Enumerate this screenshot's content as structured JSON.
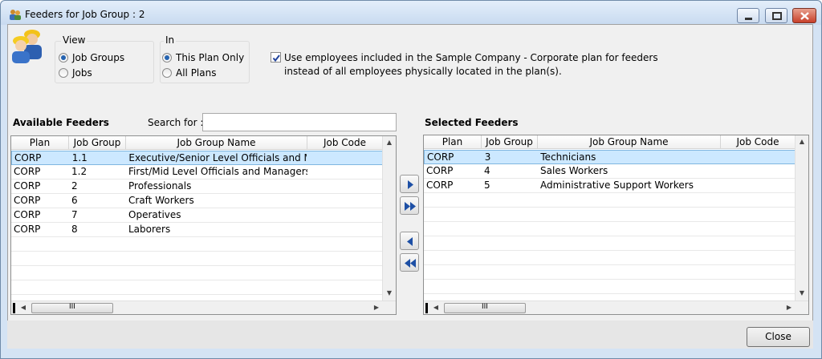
{
  "window": {
    "title": "Feeders for Job Group : 2"
  },
  "view_group": {
    "label": "View",
    "options": [
      {
        "label": "Job Groups",
        "selected": true
      },
      {
        "label": "Jobs",
        "selected": false
      }
    ]
  },
  "in_group": {
    "label": "In",
    "options": [
      {
        "label": "This Plan Only",
        "selected": true
      },
      {
        "label": "All Plans",
        "selected": false
      }
    ]
  },
  "use_employees": {
    "checked": true,
    "text": "Use employees included in the Sample Company - Corporate plan for feeders instead of all employees physically located in the plan(s)."
  },
  "available": {
    "title": "Available Feeders",
    "search_label": "Search for :",
    "search_value": "",
    "columns": [
      "Plan",
      "Job Group",
      "Job Group Name",
      "Job Code"
    ],
    "rows": [
      {
        "plan": "CORP",
        "job_group": "1.1",
        "name": "Executive/Senior Level Officials and Mana",
        "code": ""
      },
      {
        "plan": "CORP",
        "job_group": "1.2",
        "name": "First/Mid Level Officials and Managers",
        "code": ""
      },
      {
        "plan": "CORP",
        "job_group": "2",
        "name": "Professionals",
        "code": ""
      },
      {
        "plan": "CORP",
        "job_group": "6",
        "name": "Craft Workers",
        "code": ""
      },
      {
        "plan": "CORP",
        "job_group": "7",
        "name": "Operatives",
        "code": ""
      },
      {
        "plan": "CORP",
        "job_group": "8",
        "name": "Laborers",
        "code": ""
      }
    ]
  },
  "selected": {
    "title": "Selected Feeders",
    "columns": [
      "Plan",
      "Job Group",
      "Job Group Name",
      "Job Code"
    ],
    "rows": [
      {
        "plan": "CORP",
        "job_group": "3",
        "name": "Technicians",
        "code": ""
      },
      {
        "plan": "CORP",
        "job_group": "4",
        "name": "Sales Workers",
        "code": ""
      },
      {
        "plan": "CORP",
        "job_group": "5",
        "name": "Administrative Support Workers",
        "code": ""
      }
    ]
  },
  "buttons": {
    "close": "Close"
  },
  "scroll": {
    "thumb_grip": "III"
  },
  "colors": {
    "selection": "#cce8ff",
    "accent": "#2563b0"
  }
}
